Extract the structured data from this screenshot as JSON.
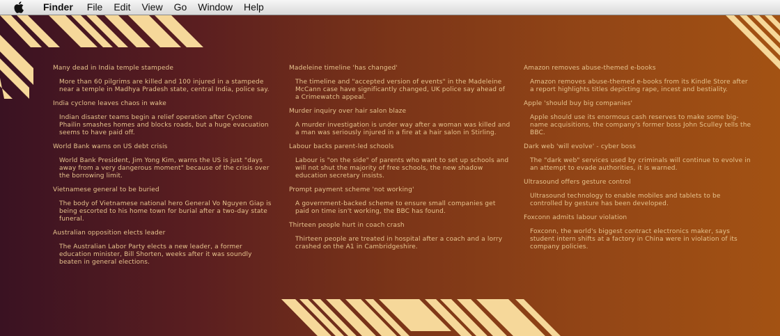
{
  "menubar": {
    "app_name": "Finder",
    "items": [
      "File",
      "Edit",
      "View",
      "Go",
      "Window",
      "Help"
    ]
  },
  "columns": [
    [
      {
        "headline": "Many dead in India temple stampede",
        "summary": "More than 60 pilgrims are killed and 100 injured in a stampede near a temple in Madhya Pradesh state, central India, police say."
      },
      {
        "headline": "India cyclone leaves chaos in wake",
        "summary": "Indian disaster teams begin a relief operation after Cyclone Phailin smashes homes and blocks roads, but a huge evacuation seems to have paid off."
      },
      {
        "headline": "World Bank warns on US debt crisis",
        "summary": "World Bank President, Jim Yong Kim, warns the US is just \"days away from a very dangerous moment\" because of the crisis over the borrowing limit."
      },
      {
        "headline": "Vietnamese general to be buried",
        "summary": "The body of Vietnamese national hero General Vo Nguyen Giap is being escorted to his home town for burial after a two-day state funeral."
      },
      {
        "headline": "Australian opposition elects leader",
        "summary": "The Australian Labor Party elects a new leader, a former education minister, Bill Shorten, weeks after it was soundly beaten in general elections."
      }
    ],
    [
      {
        "headline": "Madeleine timeline 'has changed'",
        "summary": "The timeline and \"accepted version of events\" in the Madeleine McCann case have significantly changed, UK police say ahead of a Crimewatch appeal."
      },
      {
        "headline": "Murder inquiry over hair salon blaze",
        "summary": "A murder investigation is under way after a woman was killed and a man was seriously injured in a fire at a hair salon in Stirling."
      },
      {
        "headline": "Labour backs parent-led schools",
        "summary": "Labour is \"on the side\" of parents who want to set up schools and will not shut the majority of free schools, the new shadow education secretary insists."
      },
      {
        "headline": "Prompt payment scheme 'not working'",
        "summary": "A government-backed scheme to ensure small companies get paid on time isn't working, the BBC has found."
      },
      {
        "headline": "Thirteen people hurt in coach crash",
        "summary": "Thirteen people are treated in hospital after a coach and a lorry crashed on the A1 in Cambridgeshire."
      }
    ],
    [
      {
        "headline": "Amazon removes abuse-themed e-books",
        "summary": "Amazon removes abuse-themed e-books from its Kindle Store after a report highlights titles depicting rape, incest and bestiality."
      },
      {
        "headline": "Apple 'should buy big companies'",
        "summary": "Apple should use its enormous cash reserves to make some big-name acquisitions, the company's former boss John Sculley tells the BBC."
      },
      {
        "headline": "Dark web 'will evolve' - cyber boss",
        "summary": "The \"dark web\" services used by criminals will continue to evolve in an attempt to evade authorities, it is warned."
      },
      {
        "headline": "Ultrasound offers gesture control",
        "summary": "Ultrasound technology to enable mobiles and tablets to be controlled by gesture has been developed."
      },
      {
        "headline": "Foxconn admits labour violation",
        "summary": "Foxconn, the world's biggest contract electronics maker, says student intern shifts at a factory in China were in violation of its company policies."
      }
    ]
  ],
  "colors": {
    "text": "#e7c48e",
    "stripe": "#f6d89a"
  },
  "icons": {
    "apple_menu": "apple-logo-icon"
  }
}
